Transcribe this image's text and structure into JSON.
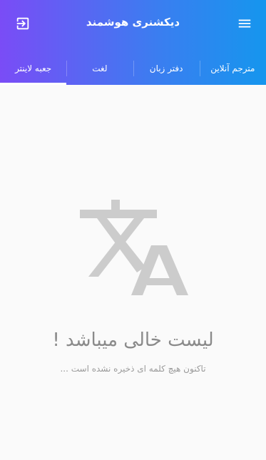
{
  "app_bar": {
    "title": "دیکشنری هوشمند",
    "left_icon": "logout-icon",
    "right_icon": "menu-icon"
  },
  "tabs": [
    {
      "label": "جعبه لاینتر",
      "active": true
    },
    {
      "label": "لغت",
      "active": false
    },
    {
      "label": "دفتر زبان",
      "active": false
    },
    {
      "label": "مترجم آنلاین",
      "active": false
    }
  ],
  "empty_state": {
    "icon": "translate-icon",
    "title": "لیست خالی میباشد !",
    "subtitle": "تاکنون هیچ کلمه ای ذخیره نشده است ..."
  },
  "colors": {
    "header_gradient_start": "#7a4cf6",
    "header_gradient_end": "#1596ee",
    "icon_gray": "#cccccc",
    "text_gray": "#8a8a8a"
  }
}
